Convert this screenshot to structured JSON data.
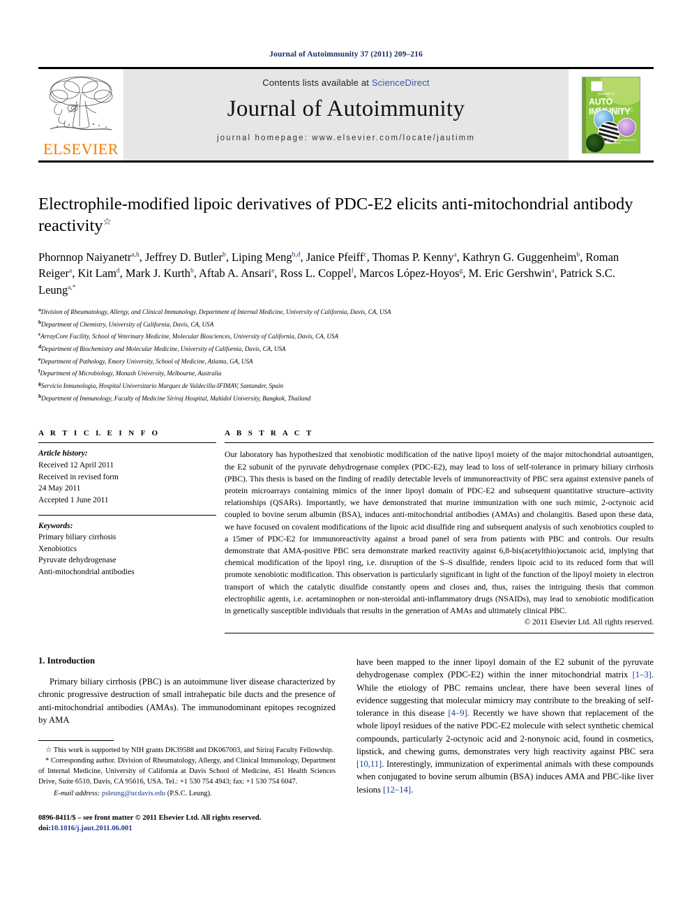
{
  "running_head": "Journal of Autoimmunity 37 (2011) 209–216",
  "masthead": {
    "contents_prefix": "Contents lists available at ",
    "contents_link": "ScienceDirect",
    "journal_title": "Journal of Autoimmunity",
    "homepage": "journal homepage: www.elsevier.com/locate/jautimm",
    "publisher_logo_text": "ELSEVIER",
    "cover": {
      "journal_of": "journal of",
      "auto_immunity": "AUTO IMMUNITY",
      "subtitle": "OFFICIAL JOURNAL OF THE INTERNATIONAL CONGRESS",
      "footer": "ELSEVIER\nwww.elsevier.com/\nlocate/jautimm",
      "background_color": "#8cc63e"
    }
  },
  "article": {
    "title": "Electrophile-modified lipoic derivatives of PDC-E2 elicits anti-mitochondrial antibody reactivity",
    "title_marker": "☆",
    "authors": [
      {
        "name": "Phornnop Naiyanetr",
        "sup": "a,h",
        "sep": ", "
      },
      {
        "name": "Jeffrey D. Butler",
        "sup": "b",
        "sep": ", "
      },
      {
        "name": "Liping Meng",
        "sup": "b,d",
        "sep": ", "
      },
      {
        "name": "Janice Pfeiff",
        "sup": "c",
        "sep": ", "
      },
      {
        "name": "Thomas P. Kenny",
        "sup": "a",
        "sep": ", "
      },
      {
        "name": "Kathryn G. Guggenheim",
        "sup": "b",
        "sep": ", "
      },
      {
        "name": "Roman Reiger",
        "sup": "a",
        "sep": ", "
      },
      {
        "name": "Kit Lam",
        "sup": "d",
        "sep": ", "
      },
      {
        "name": "Mark J. Kurth",
        "sup": "b",
        "sep": ", "
      },
      {
        "name": "Aftab A. Ansari",
        "sup": "e",
        "sep": ", "
      },
      {
        "name": "Ross L. Coppel",
        "sup": "f",
        "sep": ", "
      },
      {
        "name": "Marcos López-Hoyos",
        "sup": "g",
        "sep": ", "
      },
      {
        "name": "M. Eric Gershwin",
        "sup": "a",
        "sep": ", "
      },
      {
        "name": "Patrick S.C. Leung",
        "sup": "a,*",
        "sep": ""
      }
    ],
    "affiliations": [
      {
        "label": "a",
        "text": "Division of Rheumatology, Allergy, and Clinical Immunology, Department of Internal Medicine, University of California, Davis, CA, USA"
      },
      {
        "label": "b",
        "text": "Department of Chemistry, University of California, Davis, CA, USA"
      },
      {
        "label": "c",
        "text": "ArrayCore Facility, School of Veterinary Medicine, Molecular Biosciences, University of California, Davis, CA, USA"
      },
      {
        "label": "d",
        "text": "Department of Biochemistry and Molecular Medicine, University of California, Davis, CA, USA"
      },
      {
        "label": "e",
        "text": "Department of Pathology, Emory University, School of Medicine, Atlanta, GA, USA"
      },
      {
        "label": "f",
        "text": "Department of Microbiology, Monash University, Melbourne, Australia"
      },
      {
        "label": "g",
        "text": "Servicio Inmunologia, Hospital Universitario Marques de Valdecilla-IFIMAV, Santander, Spain"
      },
      {
        "label": "h",
        "text": "Department of Immunology, Faculty of Medicine Siriraj Hospital, Mahidol University, Bangkok, Thailand"
      }
    ]
  },
  "article_info": {
    "heading": "A R T I C L E  I N F O",
    "history_label": "Article history:",
    "history_lines": [
      "Received 12 April 2011",
      "Received in revised form",
      "24 May 2011",
      "Accepted 1 June 2011"
    ],
    "keywords_label": "Keywords:",
    "keywords": [
      "Primary biliary cirrhosis",
      "Xenobiotics",
      "Pyruvate dehydrogenase",
      "Anti-mitochondrial antibodies"
    ]
  },
  "abstract": {
    "heading": "A B S T R A C T",
    "text": "Our laboratory has hypothesized that xenobiotic modification of the native lipoyl moiety of the major mitochondrial autoantigen, the E2 subunit of the pyruvate dehydrogenase complex (PDC-E2), may lead to loss of self-tolerance in primary biliary cirrhosis (PBC). This thesis is based on the finding of readily detectable levels of immunoreactivity of PBC sera against extensive panels of protein microarrays containing mimics of the inner lipoyl domain of PDC-E2 and subsequent quantitative structure–activity relationships (QSARs). Importantly, we have demonstrated that murine immunization with one such mimic, 2-octynoic acid coupled to bovine serum albumin (BSA), induces anti-mitochondrial antibodies (AMAs) and cholangitis. Based upon these data, we have focused on covalent modifications of the lipoic acid disulfide ring and subsequent analysis of such xenobiotics coupled to a 15mer of PDC-E2 for immunoreactivity against a broad panel of sera from patients with PBC and controls. Our results demonstrate that AMA-positive PBC sera demonstrate marked reactivity against 6,8-bis(acetylthio)octanoic acid, implying that chemical modification of the lipoyl ring, i.e. disruption of the S–S disulfide, renders lipoic acid to its reduced form that will promote xenobiotic modification. This observation is particularly significant in light of the function of the lipoyl moiety in electron transport of which the catalytic disulfide constantly opens and closes and, thus, raises the intriguing thesis that common electrophilic agents, i.e. acetaminophen or non-steroidal anti-inflammatory drugs (NSAIDs), may lead to xenobiotic modification in genetically susceptible individuals that results in the generation of AMAs and ultimately clinical PBC.",
    "copyright": "© 2011 Elsevier Ltd. All rights reserved."
  },
  "body": {
    "section_number_title": "1.  Introduction",
    "left_paragraph": "Primary biliary cirrhosis (PBC) is an autoimmune liver disease characterized by chronic progressive destruction of small intrahepatic bile ducts and the presence of anti-mitochondrial antibodies (AMAs). The immunodominant epitopes recognized by AMA",
    "right_paragraph_parts": [
      {
        "t": "have been mapped to the inner lipoyl domain of the E2 subunit of the pyruvate dehydrogenase complex (PDC-E2) within the inner mitochondrial matrix ",
        "cite": false
      },
      {
        "t": "[1–3]",
        "cite": true
      },
      {
        "t": ". While the etiology of PBC remains unclear, there have been several lines of evidence suggesting that molecular mimicry may contribute to the breaking of self-tolerance in this disease ",
        "cite": false
      },
      {
        "t": "[4–9]",
        "cite": true
      },
      {
        "t": ". Recently we have shown that replacement of the whole lipoyl residues of the native PDC-E2 molecule with select synthetic chemical compounds, particularly 2-octynoic acid and 2-nonynoic acid, found in cosmetics, lipstick, and chewing gums, demonstrates very high reactivity against PBC sera ",
        "cite": false
      },
      {
        "t": "[10,11]",
        "cite": true
      },
      {
        "t": ". Interestingly, immunization of experimental animals with these compounds when conjugated to bovine serum albumin (BSA) induces AMA and PBC-like liver lesions ",
        "cite": false
      },
      {
        "t": "[12–14]",
        "cite": true
      },
      {
        "t": ".",
        "cite": false
      }
    ]
  },
  "footnotes": {
    "funding_marker": "☆",
    "funding": "This work is supported by NIH grants DK39588 and DK067003, and Siriraj Faculty Fellowship.",
    "corresponding_marker": "*",
    "corresponding": "Corresponding author. Division of Rheumatology, Allergy, and Clinical Immunology, Department of Internal Medicine, University of California at Davis School of Medicine, 451 Health Sciences Drive, Suite 6510, Davis, CA 95616, USA. Tel.: +1 530 754 4943; fax: +1 530 754 6047.",
    "email_label": "E-mail address:",
    "email": "psleung@ucdavis.edu",
    "email_owner": "(P.S.C. Leung).",
    "issn_line": "0896-8411/$ – see front matter © 2011 Elsevier Ltd. All rights reserved.",
    "doi_label": "doi:",
    "doi": "10.1016/j.jaut.2011.06.001"
  }
}
